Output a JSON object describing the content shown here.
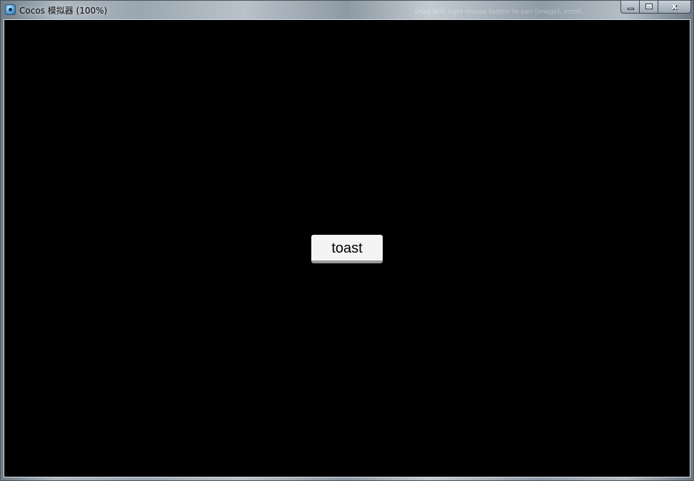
{
  "window": {
    "title": "Cocos 模拟器 (100%)",
    "hint": "Drag with right mouse button to pan (image), scroll..."
  },
  "controls": {
    "minimize_icon": "minimize-icon",
    "maximize_icon": "maximize-icon",
    "close_icon": "close-icon",
    "close_glyph": "x"
  },
  "scene": {
    "button_label": "toast"
  }
}
